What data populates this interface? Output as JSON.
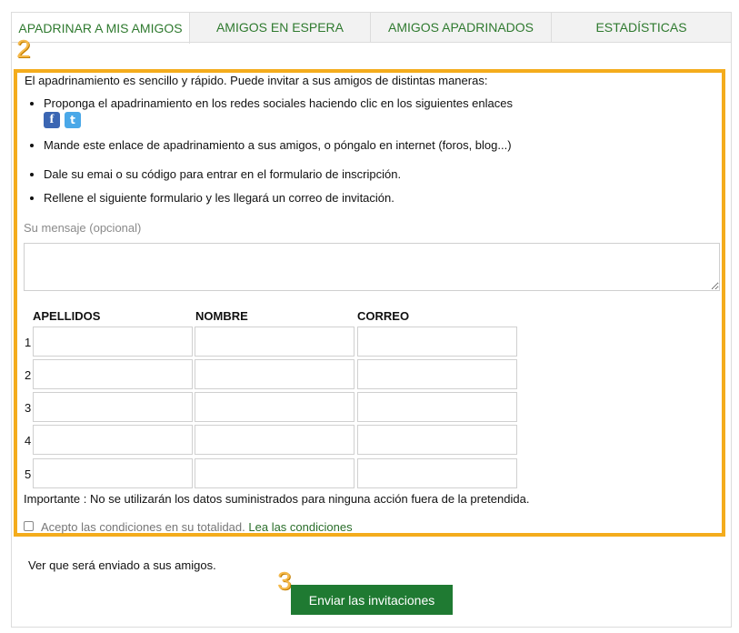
{
  "tabs": [
    {
      "label": "APADRINAR A MIS AMIGOS",
      "active": true
    },
    {
      "label": "AMIGOS EN ESPERA"
    },
    {
      "label": "AMIGOS APADRINADOS"
    },
    {
      "label": "ESTADÍSTICAS"
    }
  ],
  "step_markers": {
    "two": "2",
    "three": "3"
  },
  "intro": "El apadrinamiento es sencillo y rápido. Puede invitar a sus amigos de distintas maneras:",
  "options": [
    "Proponga el apadrinamiento en los redes sociales haciendo clic en los siguientes enlaces",
    "Mande este enlace de apadrinamiento a sus amigos, o póngalo en internet (foros, blog...)",
    "Dale su emai o su código para entrar en el formulario de inscripción.",
    "Rellene el siguiente formulario y les llegará un correo de invitación."
  ],
  "social": {
    "facebook_glyph": "f",
    "twitter_glyph": "t",
    "facebook_icon": "facebook-icon",
    "twitter_icon": "twitter-icon"
  },
  "message": {
    "label": "Su mensaje (opcional)",
    "value": ""
  },
  "table": {
    "headers": [
      "APELLIDOS",
      "NOMBRE",
      "CORREO"
    ],
    "rows": [
      "1",
      "2",
      "3",
      "4",
      "5"
    ]
  },
  "important": "Importante : No se utilizarán los datos suministrados para ninguna acción fuera de la pretendida.",
  "conditions": {
    "text": "Acepto las condiciones en su totalidad.",
    "link": "Lea las condiciones",
    "checked": false
  },
  "preview_text": "Ver que será enviado a sus amigos.",
  "submit_label": "Enviar las invitaciones",
  "colors": {
    "accent": "#2f7a2f",
    "highlight": "#f4ac1c",
    "button": "#1f7a32"
  }
}
